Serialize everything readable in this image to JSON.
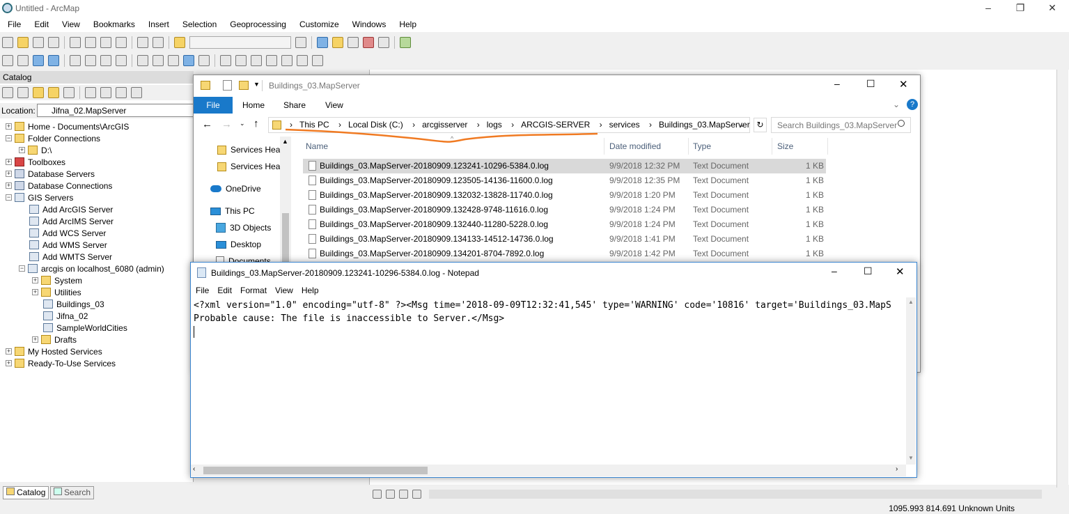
{
  "arcmap": {
    "title": "Untitled - ArcMap",
    "menu": [
      "File",
      "Edit",
      "View",
      "Bookmarks",
      "Insert",
      "Selection",
      "Geoprocessing",
      "Customize",
      "Windows",
      "Help"
    ],
    "status": "1095.993  814.691 Unknown Units"
  },
  "catalog": {
    "title": "Catalog",
    "location_label": "Location:",
    "location_value": "Jifna_02.MapServer",
    "tree": [
      {
        "label": "Home - Documents\\ArcGIS",
        "exp": "+",
        "icon": "fd"
      },
      {
        "label": "Folder Connections",
        "exp": "−",
        "icon": "fd"
      },
      {
        "label": "D:\\",
        "exp": "+",
        "icon": "fd"
      },
      {
        "label": "Toolboxes",
        "exp": "+",
        "icon": "tb"
      },
      {
        "label": "Database Servers",
        "exp": "+",
        "icon": "db"
      },
      {
        "label": "Database Connections",
        "exp": "+",
        "icon": "db"
      },
      {
        "label": "GIS Servers",
        "exp": "−",
        "icon": "gs"
      },
      {
        "label": "Add ArcGIS Server",
        "exp": "",
        "icon": "gs"
      },
      {
        "label": "Add ArcIMS Server",
        "exp": "",
        "icon": "gs"
      },
      {
        "label": "Add WCS Server",
        "exp": "",
        "icon": "gs"
      },
      {
        "label": "Add WMS Server",
        "exp": "",
        "icon": "gs"
      },
      {
        "label": "Add WMTS Server",
        "exp": "",
        "icon": "gs"
      },
      {
        "label": "arcgis on localhost_6080 (admin)",
        "exp": "−",
        "icon": "gs"
      },
      {
        "label": "System",
        "exp": "+",
        "icon": "fd"
      },
      {
        "label": "Utilities",
        "exp": "+",
        "icon": "fd"
      },
      {
        "label": "Buildings_03",
        "exp": "",
        "icon": "gs"
      },
      {
        "label": "Jifna_02",
        "exp": "",
        "icon": "gs"
      },
      {
        "label": "SampleWorldCities",
        "exp": "",
        "icon": "gs"
      },
      {
        "label": "Drafts",
        "exp": "+",
        "icon": "fd"
      },
      {
        "label": "My Hosted Services",
        "exp": "+",
        "icon": "fd"
      },
      {
        "label": "Ready-To-Use Services",
        "exp": "+",
        "icon": "fd"
      }
    ],
    "tabs": {
      "catalog": "Catalog",
      "search": "Search"
    }
  },
  "explorer": {
    "title": "Buildings_03.MapServer",
    "ribbon": {
      "file": "File",
      "home": "Home",
      "share": "Share",
      "view": "View"
    },
    "path": [
      "This PC",
      "Local Disk (C:)",
      "arcgisserver",
      "logs",
      "ARCGIS-SERVER",
      "services",
      "Buildings_03.MapServer"
    ],
    "search_placeholder": "Search Buildings_03.MapServer",
    "nav": [
      "Services Heal",
      "Services Heal",
      "OneDrive",
      "This PC",
      "3D Objects",
      "Desktop",
      "Documents"
    ],
    "columns": {
      "name": "Name",
      "date": "Date modified",
      "type": "Type",
      "size": "Size"
    },
    "files": [
      {
        "name": "Buildings_03.MapServer-20180909.123241-10296-5384.0.log",
        "date": "9/9/2018 12:32 PM",
        "type": "Text Document",
        "size": "1 KB"
      },
      {
        "name": "Buildings_03.MapServer-20180909.123505-14136-11600.0.log",
        "date": "9/9/2018 12:35 PM",
        "type": "Text Document",
        "size": "1 KB"
      },
      {
        "name": "Buildings_03.MapServer-20180909.132032-13828-11740.0.log",
        "date": "9/9/2018 1:20 PM",
        "type": "Text Document",
        "size": "1 KB"
      },
      {
        "name": "Buildings_03.MapServer-20180909.132428-9748-11616.0.log",
        "date": "9/9/2018 1:24 PM",
        "type": "Text Document",
        "size": "1 KB"
      },
      {
        "name": "Buildings_03.MapServer-20180909.132440-11280-5228.0.log",
        "date": "9/9/2018 1:24 PM",
        "type": "Text Document",
        "size": "1 KB"
      },
      {
        "name": "Buildings_03.MapServer-20180909.134133-14512-14736.0.log",
        "date": "9/9/2018 1:41 PM",
        "type": "Text Document",
        "size": "1 KB"
      },
      {
        "name": "Buildings_03.MapServer-20180909.134201-8704-7892.0.log",
        "date": "9/9/2018 1:42 PM",
        "type": "Text Document",
        "size": "1 KB"
      }
    ]
  },
  "notepad": {
    "title": "Buildings_03.MapServer-20180909.123241-10296-5384.0.log - Notepad",
    "menu": [
      "File",
      "Edit",
      "Format",
      "View",
      "Help"
    ],
    "line1": "<?xml version=\"1.0\" encoding=\"utf-8\" ?><Msg time='2018-09-09T12:32:41,545' type='WARNING' code='10816' target='Buildings_03.MapS",
    "line2": "Probable cause: The file is inaccessible to Server.</Msg>"
  },
  "colors": {
    "accent": "#1979ca",
    "annotation": "#f07a22",
    "selection": "#d9d9d9"
  }
}
